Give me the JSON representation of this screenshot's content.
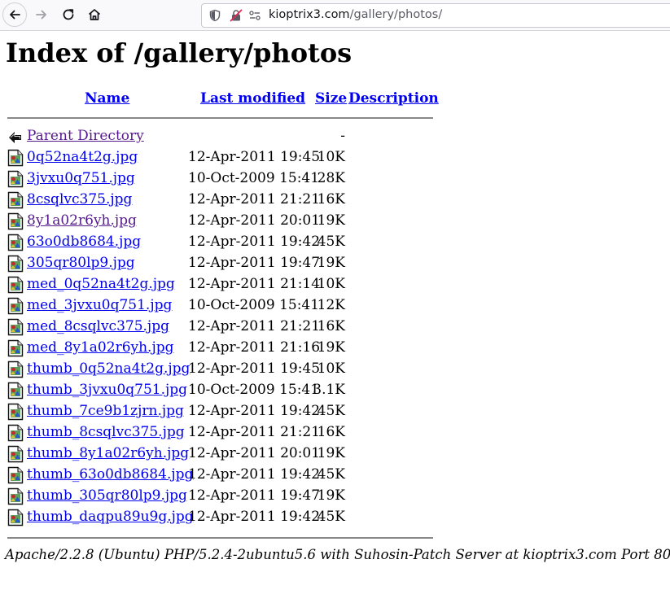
{
  "browser": {
    "url_host": "kioptrix3.com",
    "url_path": "/gallery/photos/"
  },
  "page": {
    "title": "Index of /gallery/photos",
    "columns": {
      "name": "Name",
      "last_modified": "Last modified",
      "size": "Size",
      "description": "Description"
    },
    "parent": {
      "name": "Parent Directory",
      "size": "-"
    },
    "files": [
      {
        "name": "0q52na4t2g.jpg",
        "modified": "12-Apr-2011 19:45",
        "size": "10K"
      },
      {
        "name": "3jvxu0q751.jpg",
        "modified": "10-Oct-2009 15:41",
        "size": "28K"
      },
      {
        "name": "8csqlvc375.jpg",
        "modified": "12-Apr-2011 21:21",
        "size": "16K"
      },
      {
        "name": "8y1a02r6yh.jpg",
        "modified": "12-Apr-2011 20:01",
        "size": "19K"
      },
      {
        "name": "63o0db8684.jpg",
        "modified": "12-Apr-2011 19:42",
        "size": "45K"
      },
      {
        "name": "305qr80lp9.jpg",
        "modified": "12-Apr-2011 19:47",
        "size": "19K"
      },
      {
        "name": "med_0q52na4t2g.jpg",
        "modified": "12-Apr-2011 21:14",
        "size": "10K"
      },
      {
        "name": "med_3jvxu0q751.jpg",
        "modified": "10-Oct-2009 15:41",
        "size": "12K"
      },
      {
        "name": "med_8csqlvc375.jpg",
        "modified": "12-Apr-2011 21:21",
        "size": "16K"
      },
      {
        "name": "med_8y1a02r6yh.jpg",
        "modified": "12-Apr-2011 21:16",
        "size": "19K"
      },
      {
        "name": "thumb_0q52na4t2g.jpg",
        "modified": "12-Apr-2011 19:45",
        "size": "10K"
      },
      {
        "name": "thumb_3jvxu0q751.jpg",
        "modified": "10-Oct-2009 15:41",
        "size": "3.1K"
      },
      {
        "name": "thumb_7ce9b1zjrn.jpg",
        "modified": "12-Apr-2011 19:42",
        "size": "45K"
      },
      {
        "name": "thumb_8csqlvc375.jpg",
        "modified": "12-Apr-2011 21:21",
        "size": "16K"
      },
      {
        "name": "thumb_8y1a02r6yh.jpg",
        "modified": "12-Apr-2011 20:01",
        "size": "19K"
      },
      {
        "name": "thumb_63o0db8684.jpg",
        "modified": "12-Apr-2011 19:42",
        "size": "45K"
      },
      {
        "name": "thumb_305qr80lp9.jpg",
        "modified": "12-Apr-2011 19:47",
        "size": "19K"
      },
      {
        "name": "thumb_daqpu89u9g.jpg",
        "modified": "12-Apr-2011 19:42",
        "size": "45K"
      }
    ],
    "footer": "Apache/2.2.8 (Ubuntu) PHP/5.2.4-2ubuntu5.6 with Suhosin-Patch Server at kioptrix3.com Port 80"
  },
  "colors": {
    "link": "#0000ee",
    "visited_link": "#551a8b",
    "rule": "#888888"
  },
  "icons": {
    "back": "arrow-left-icon",
    "forward": "arrow-right-icon",
    "reload": "reload-icon",
    "home": "home-icon",
    "parent": "back-folder-icon",
    "file": "image-file-icon"
  }
}
